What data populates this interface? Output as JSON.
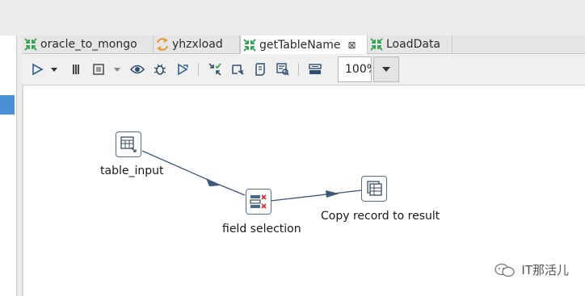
{
  "tabs": [
    {
      "label": "oracle_to_mongo",
      "icon": "transformation-icon",
      "active": false
    },
    {
      "label": "yhzxload",
      "icon": "job-icon",
      "active": false
    },
    {
      "label": "getTableName",
      "icon": "transformation-icon",
      "active": true,
      "close": "⊠"
    },
    {
      "label": "LoadData",
      "icon": "transformation-icon",
      "active": false
    }
  ],
  "toolbar": {
    "zoom_value": "100%",
    "buttons": [
      "run-icon",
      "run-options-icon",
      "pause-icon",
      "stop-icon",
      "stop-options-icon",
      "preview-icon",
      "debug-icon",
      "replay-icon",
      "verify-icon",
      "impact-icon",
      "sql-icon",
      "explore-db-icon",
      "show-results-icon"
    ]
  },
  "canvas": {
    "steps": [
      {
        "label": "table_input",
        "icon": "table-input-icon"
      },
      {
        "label": "field selection",
        "icon": "select-values-icon"
      },
      {
        "label": "Copy record to result",
        "icon": "copy-rows-icon"
      }
    ],
    "hops": [
      {
        "from": "table_input",
        "to": "field selection"
      },
      {
        "from": "field selection",
        "to": "Copy record to result"
      }
    ]
  },
  "watermark": {
    "text": "IT那活儿",
    "icon": "wechat-icon"
  },
  "colors": {
    "hop": "#3c5a78",
    "node_border": "#5a6e88",
    "selection": "#4a90d9"
  }
}
